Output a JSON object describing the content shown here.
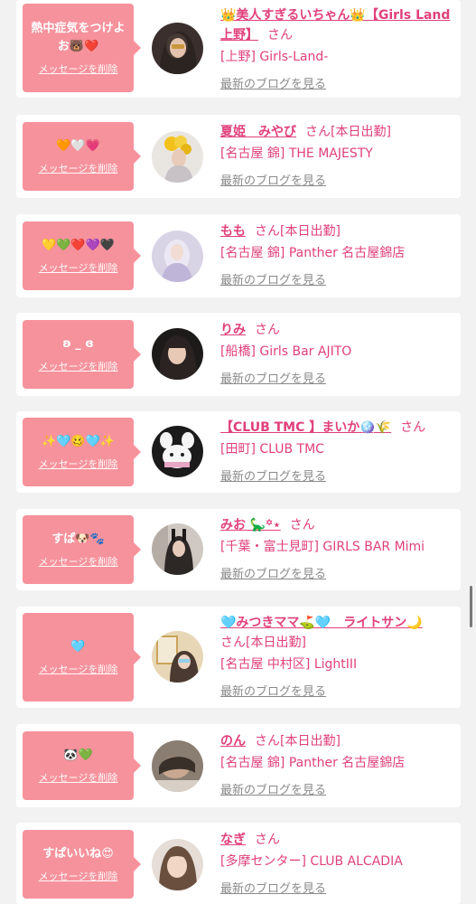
{
  "delete_label": "メッセージを削除",
  "blog_label": "最新のブログを見る",
  "san_label": "さん",
  "items": [
    {
      "message": "熱中症気をつけよお🐻❤️",
      "name": "👑美人すぎるいちゃん👑【Girls Land上野】",
      "status": "",
      "shop": "[上野] Girls-Land-"
    },
    {
      "message": "🧡🤍💗",
      "name": "夏姫　みやび",
      "status": "[本日出勤]",
      "shop": "[名古屋 錦] THE MAJESTY"
    },
    {
      "message": "💛💚❤️💜🖤",
      "name": "もも",
      "status": "[本日出勤]",
      "shop": "[名古屋 錦] Panther 名古屋錦店"
    },
    {
      "message": "ʚ _ ɞ",
      "name": "りみ",
      "status": "",
      "shop": "[船橋] Girls Bar AJITO"
    },
    {
      "message": "✨🩵🥴🩵✨",
      "name": "【CLUB TMC 】まいか🪩🌾",
      "status": "",
      "shop": "[田町] CLUB TMC"
    },
    {
      "message": "すぱ🐶🐾",
      "name": "みお 🦕꙳⋆",
      "status": "",
      "shop": "[千葉・富士見町] GIRLS BAR Mimi"
    },
    {
      "message": "🩵",
      "name": "🩵みつきママ⛳️🩵　ライトサン🌙",
      "status": "[本日出勤]",
      "shop": "[名古屋 中村区] LightIII"
    },
    {
      "message": "🐼💚",
      "name": "のん",
      "status": "[本日出勤]",
      "shop": "[名古屋 錦] Panther 名古屋錦店"
    },
    {
      "message": "すぱいいね😍",
      "name": "なぎ",
      "status": "",
      "shop": "[多摩センター] CLUB ALCADIA"
    }
  ],
  "colors": {
    "accent": "#e0407c",
    "bubble": "#f6929c",
    "muted": "#8a8a8a",
    "background": "#f2f2f2"
  }
}
